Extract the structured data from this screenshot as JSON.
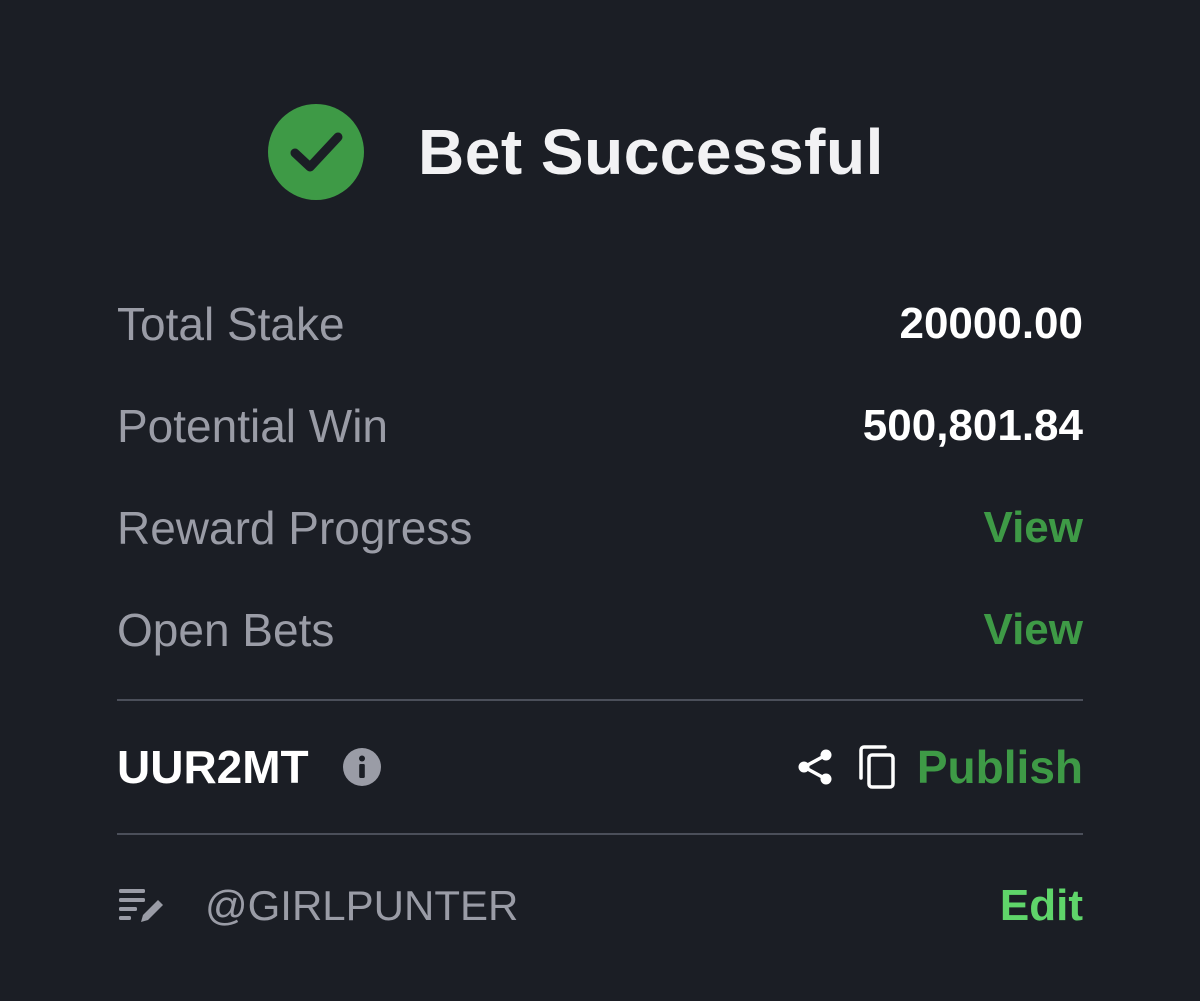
{
  "header": {
    "title": "Bet Successful",
    "status_color": "#3e9a46",
    "icon": "check-circle-icon"
  },
  "summary": {
    "total_stake_label": "Total Stake",
    "total_stake_value": "20000.00",
    "potential_win_label": "Potential Win",
    "potential_win_value": "500,801.84",
    "reward_progress_label": "Reward Progress",
    "reward_progress_link": "View",
    "open_bets_label": "Open Bets",
    "open_bets_link": "View"
  },
  "booking": {
    "code": "UUR2MT",
    "info_icon": "info-icon",
    "share_icon": "share-icon",
    "copy_icon": "copy-icon",
    "publish_label": "Publish"
  },
  "footer": {
    "note_icon": "edit-note-icon",
    "username": "@GIRLPUNTER",
    "edit_label": "Edit"
  },
  "colors": {
    "background": "#1b1e25",
    "link_green": "#3e9a46",
    "edit_green": "#5fd56a",
    "muted_text": "#9a9ca6"
  }
}
